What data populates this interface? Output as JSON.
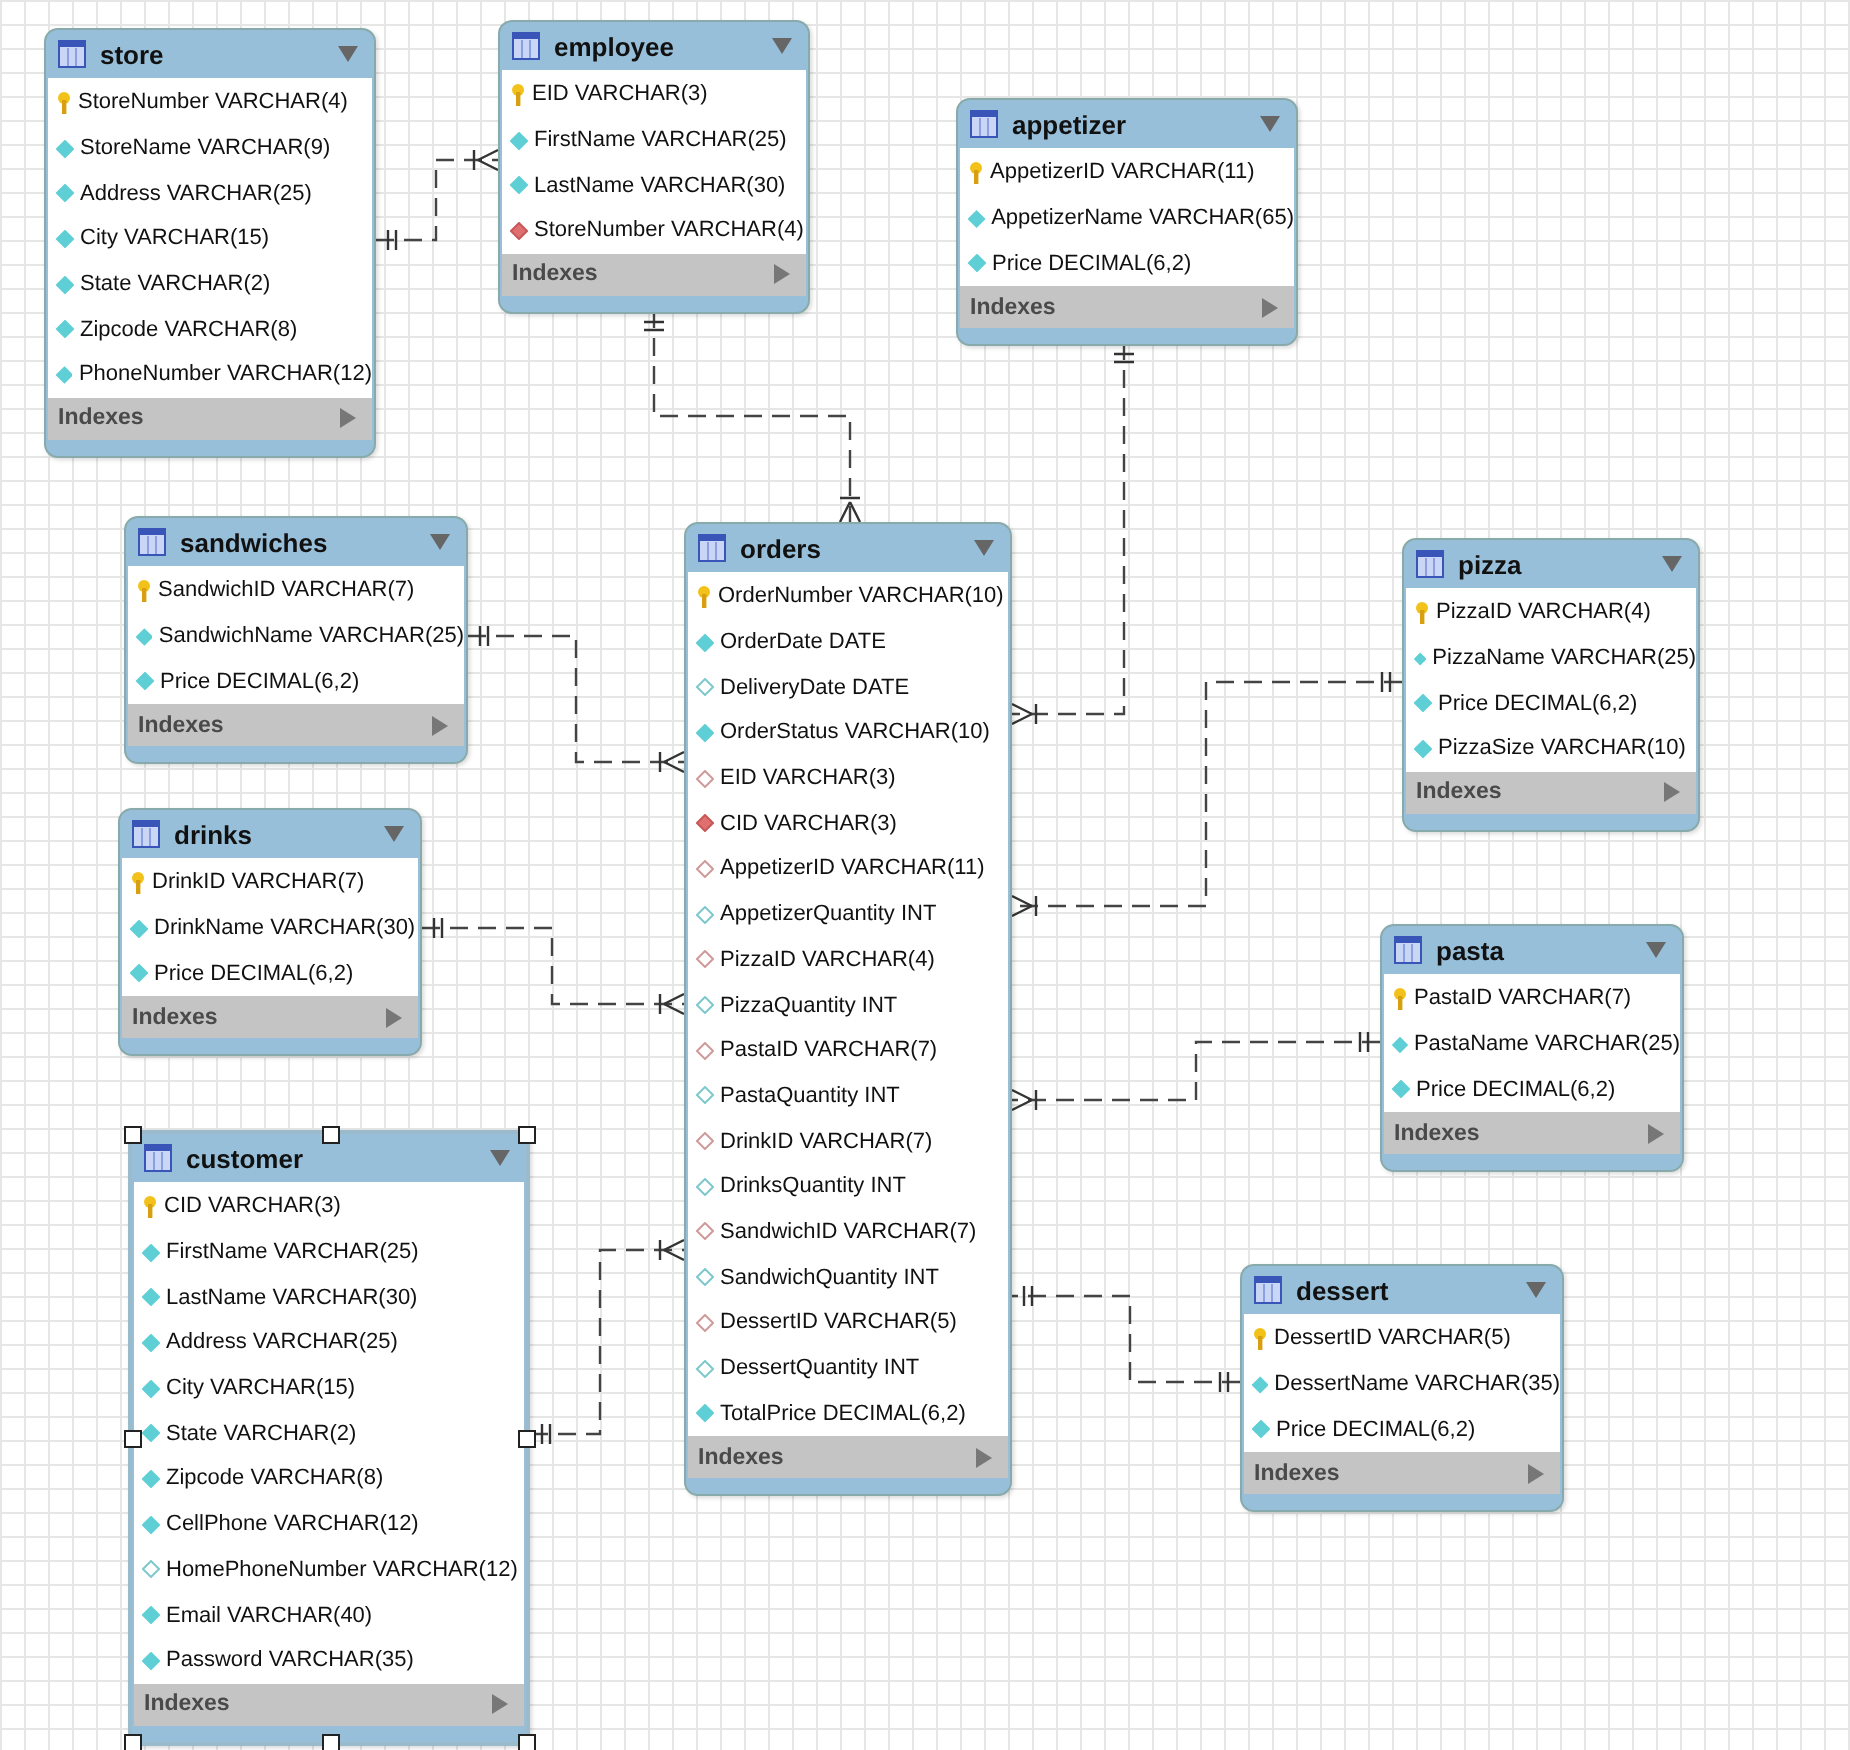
{
  "tables": [
    {
      "name": "store",
      "selected": false,
      "columns": [
        {
          "name": "StoreNumber VARCHAR(4)",
          "kind": "pk"
        },
        {
          "name": "StoreName VARCHAR(9)",
          "kind": "attr"
        },
        {
          "name": "Address VARCHAR(25)",
          "kind": "attr"
        },
        {
          "name": "City VARCHAR(15)",
          "kind": "attr"
        },
        {
          "name": "State VARCHAR(2)",
          "kind": "attr"
        },
        {
          "name": "Zipcode VARCHAR(8)",
          "kind": "attr"
        },
        {
          "name": "PhoneNumber VARCHAR(12)",
          "kind": "attr"
        }
      ],
      "indexes": "Indexes"
    },
    {
      "name": "employee",
      "selected": false,
      "columns": [
        {
          "name": "EID VARCHAR(3)",
          "kind": "pk"
        },
        {
          "name": "FirstName VARCHAR(25)",
          "kind": "attr"
        },
        {
          "name": "LastName VARCHAR(30)",
          "kind": "attr"
        },
        {
          "name": "StoreNumber VARCHAR(4)",
          "kind": "fk"
        }
      ],
      "indexes": "Indexes"
    },
    {
      "name": "appetizer",
      "selected": false,
      "columns": [
        {
          "name": "AppetizerID VARCHAR(11)",
          "kind": "pk"
        },
        {
          "name": "AppetizerName VARCHAR(65)",
          "kind": "attr"
        },
        {
          "name": "Price DECIMAL(6,2)",
          "kind": "attr"
        }
      ],
      "indexes": "Indexes"
    },
    {
      "name": "sandwiches",
      "selected": false,
      "columns": [
        {
          "name": "SandwichID VARCHAR(7)",
          "kind": "pk"
        },
        {
          "name": "SandwichName VARCHAR(25)",
          "kind": "attr"
        },
        {
          "name": "Price DECIMAL(6,2)",
          "kind": "attr"
        }
      ],
      "indexes": "Indexes"
    },
    {
      "name": "orders",
      "selected": false,
      "columns": [
        {
          "name": "OrderNumber VARCHAR(10)",
          "kind": "pk"
        },
        {
          "name": "OrderDate DATE",
          "kind": "attr"
        },
        {
          "name": "DeliveryDate DATE",
          "kind": "attr_null"
        },
        {
          "name": "OrderStatus VARCHAR(10)",
          "kind": "attr"
        },
        {
          "name": "EID VARCHAR(3)",
          "kind": "fk_null"
        },
        {
          "name": "CID VARCHAR(3)",
          "kind": "fk"
        },
        {
          "name": "AppetizerID VARCHAR(11)",
          "kind": "fk_null"
        },
        {
          "name": "AppetizerQuantity INT",
          "kind": "attr_null"
        },
        {
          "name": "PizzaID VARCHAR(4)",
          "kind": "fk_null"
        },
        {
          "name": "PizzaQuantity INT",
          "kind": "attr_null"
        },
        {
          "name": "PastaID VARCHAR(7)",
          "kind": "fk_null"
        },
        {
          "name": "PastaQuantity INT",
          "kind": "attr_null"
        },
        {
          "name": "DrinkID VARCHAR(7)",
          "kind": "fk_null"
        },
        {
          "name": "DrinksQuantity INT",
          "kind": "attr_null"
        },
        {
          "name": "SandwichID VARCHAR(7)",
          "kind": "fk_null"
        },
        {
          "name": "SandwichQuantity INT",
          "kind": "attr_null"
        },
        {
          "name": "DessertID VARCHAR(5)",
          "kind": "fk_null"
        },
        {
          "name": "DessertQuantity INT",
          "kind": "attr_null"
        },
        {
          "name": "TotalPrice DECIMAL(6,2)",
          "kind": "attr"
        }
      ],
      "indexes": "Indexes"
    },
    {
      "name": "pizza",
      "selected": false,
      "columns": [
        {
          "name": "PizzaID VARCHAR(4)",
          "kind": "pk"
        },
        {
          "name": "PizzaName VARCHAR(25)",
          "kind": "attr"
        },
        {
          "name": "Price DECIMAL(6,2)",
          "kind": "attr"
        },
        {
          "name": "PizzaSize VARCHAR(10)",
          "kind": "attr"
        }
      ],
      "indexes": "Indexes"
    },
    {
      "name": "drinks",
      "selected": false,
      "columns": [
        {
          "name": "DrinkID VARCHAR(7)",
          "kind": "pk"
        },
        {
          "name": "DrinkName VARCHAR(30)",
          "kind": "attr"
        },
        {
          "name": "Price DECIMAL(6,2)",
          "kind": "attr"
        }
      ],
      "indexes": "Indexes"
    },
    {
      "name": "pasta",
      "selected": false,
      "columns": [
        {
          "name": "PastaID VARCHAR(7)",
          "kind": "pk"
        },
        {
          "name": "PastaName VARCHAR(25)",
          "kind": "attr"
        },
        {
          "name": "Price DECIMAL(6,2)",
          "kind": "attr"
        }
      ],
      "indexes": "Indexes"
    },
    {
      "name": "customer",
      "selected": true,
      "columns": [
        {
          "name": "CID VARCHAR(3)",
          "kind": "pk"
        },
        {
          "name": "FirstName VARCHAR(25)",
          "kind": "attr"
        },
        {
          "name": "LastName VARCHAR(30)",
          "kind": "attr"
        },
        {
          "name": "Address VARCHAR(25)",
          "kind": "attr"
        },
        {
          "name": "City VARCHAR(15)",
          "kind": "attr"
        },
        {
          "name": "State VARCHAR(2)",
          "kind": "attr"
        },
        {
          "name": "Zipcode VARCHAR(8)",
          "kind": "attr"
        },
        {
          "name": "CellPhone VARCHAR(12)",
          "kind": "attr"
        },
        {
          "name": "HomePhoneNumber VARCHAR(12)",
          "kind": "attr_null"
        },
        {
          "name": "Email VARCHAR(40)",
          "kind": "attr"
        },
        {
          "name": "Password VARCHAR(35)",
          "kind": "attr"
        }
      ],
      "indexes": "Indexes"
    },
    {
      "name": "dessert",
      "selected": false,
      "columns": [
        {
          "name": "DessertID VARCHAR(5)",
          "kind": "pk"
        },
        {
          "name": "DessertName VARCHAR(35)",
          "kind": "attr"
        },
        {
          "name": "Price DECIMAL(6,2)",
          "kind": "attr"
        }
      ],
      "indexes": "Indexes"
    }
  ]
}
